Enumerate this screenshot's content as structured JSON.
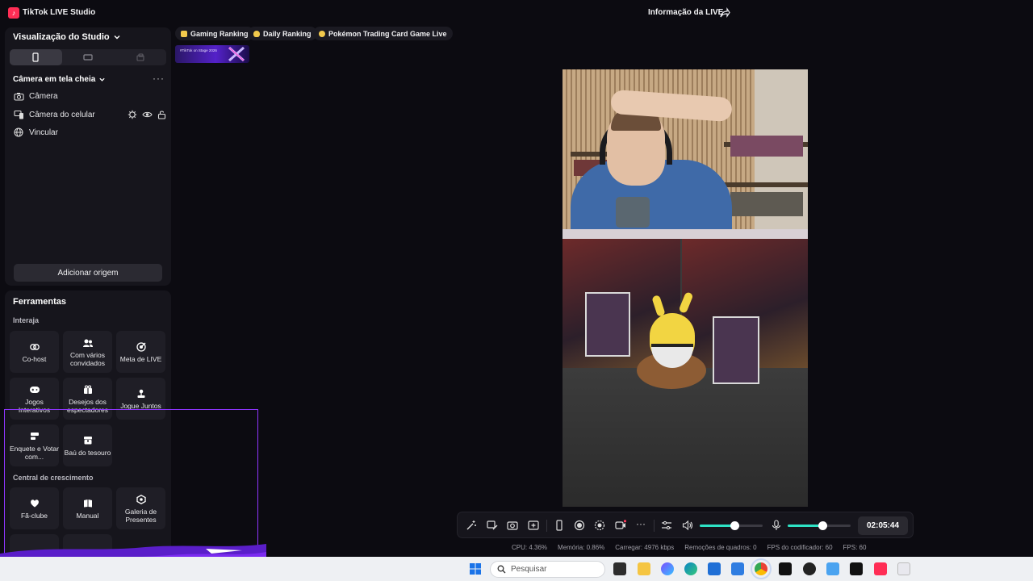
{
  "app": {
    "title": "TikTok LIVE Studio",
    "live_info": "Informação da LIVE"
  },
  "studio": {
    "title": "Visualização do Studio",
    "scene": "Câmera em tela cheia",
    "sources": [
      {
        "label": "Câmera",
        "icon": "camera-icon"
      },
      {
        "label": "Câmera do celular",
        "icon": "phone-camera-icon"
      },
      {
        "label": "Vincular",
        "icon": "globe-icon"
      }
    ],
    "add_source": "Adicionar origem"
  },
  "tools": {
    "title": "Ferramentas",
    "section_interact": "Interaja",
    "section_growth": "Central de crescimento",
    "interact": [
      {
        "label": "Co-host",
        "icon": "link-icon"
      },
      {
        "label": "Com vários convidados",
        "icon": "users-icon"
      },
      {
        "label": "Meta de LIVE",
        "icon": "target-icon"
      },
      {
        "label": "Jogos Interativos",
        "icon": "gamepad-icon"
      },
      {
        "label": "Desejos dos espectadores",
        "icon": "gift-icon"
      },
      {
        "label": "Jogue Juntos",
        "icon": "joystick-icon"
      },
      {
        "label": "Enquete e Votar com...",
        "icon": "poll-icon"
      },
      {
        "label": "Baú do tesouro",
        "icon": "chest-icon"
      }
    ],
    "growth": [
      {
        "label": "Fã-clube",
        "icon": "heart-icon"
      },
      {
        "label": "Manual",
        "icon": "book-icon"
      },
      {
        "label": "Galeria de Presentes",
        "icon": "gallery-icon"
      }
    ]
  },
  "rankings": [
    {
      "label": "Gaming Ranking",
      "color": "#f2c94c"
    },
    {
      "label": "Daily Ranking",
      "color": "#f2c94c"
    },
    {
      "label": "Pokémon Trading Card Game Live",
      "color": "#f2c94c"
    }
  ],
  "banner": {
    "text": "#TikTok on Stage 2026"
  },
  "controls": {
    "timer": "02:05:44",
    "volume": 0.55,
    "mic": 0.55
  },
  "stats": {
    "cpu": "CPU:  4.36%",
    "memory": "Memória:  0.86%",
    "upload": "Carregar:  4976 kbps",
    "dropped": "Remoções de quadros:  0",
    "encoder_fps": "FPS do codificador:  60",
    "fps": "FPS:  60"
  },
  "taskbar": {
    "search_placeholder": "Pesquisar"
  },
  "colors": {
    "accent": "#2ee3c5",
    "tiktok": "#ff2d55",
    "frame": "#8f35ff"
  }
}
